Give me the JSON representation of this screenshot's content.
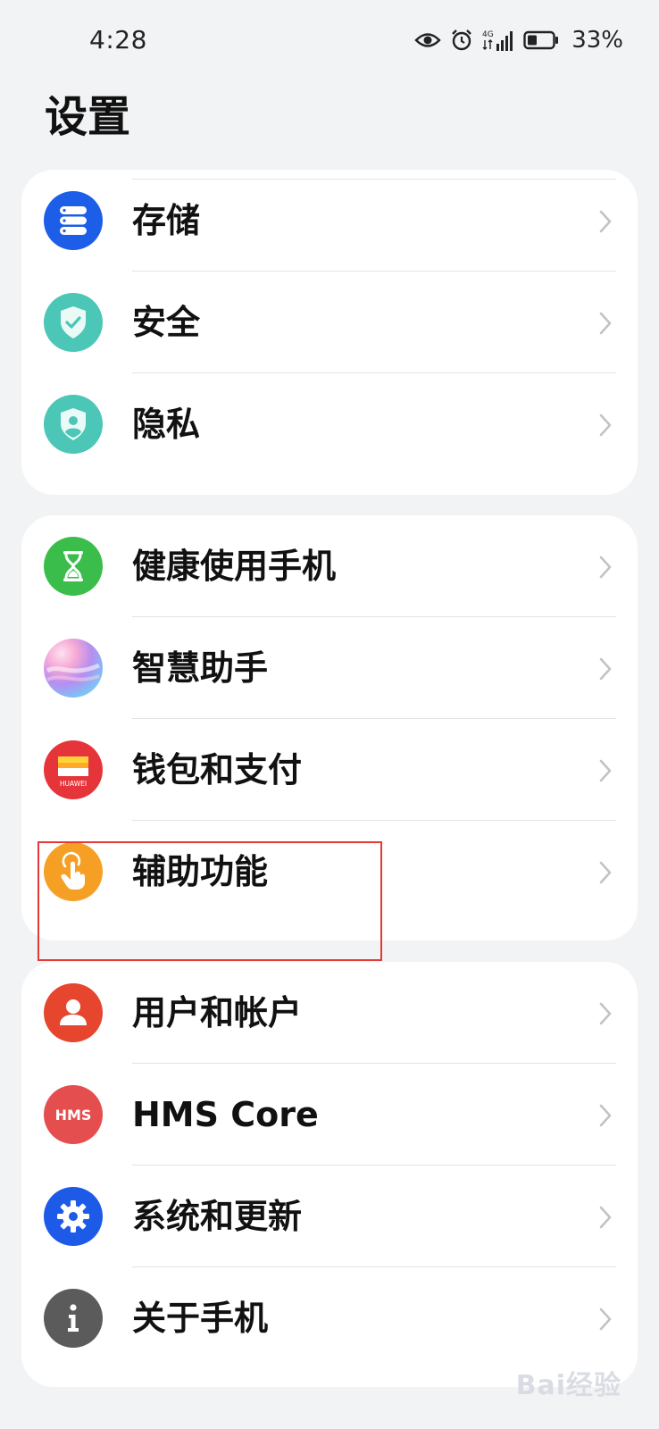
{
  "status_bar": {
    "time": "4:28",
    "network": "4G",
    "battery_percent": "33%"
  },
  "page": {
    "title": "设置"
  },
  "groups": [
    {
      "items": [
        {
          "label": "存储",
          "icon": "storage-icon",
          "color": "#1d5ee8"
        },
        {
          "label": "安全",
          "icon": "shield-check-icon",
          "color": "#4cc6b6"
        },
        {
          "label": "隐私",
          "icon": "privacy-shield-icon",
          "color": "#4cc6b6"
        }
      ]
    },
    {
      "items": [
        {
          "label": "健康使用手机",
          "icon": "hourglass-icon",
          "color": "#3bbd4b"
        },
        {
          "label": "智慧助手",
          "icon": "assistant-orb-icon",
          "color": "#b68ef0"
        },
        {
          "label": "钱包和支付",
          "icon": "wallet-icon",
          "color": "#e5353b",
          "brand": "HUAWEI"
        },
        {
          "label": "辅助功能",
          "icon": "hand-tap-icon",
          "color": "#f5a025"
        }
      ]
    },
    {
      "items": [
        {
          "label": "用户和帐户",
          "icon": "user-icon",
          "color": "#e6452e"
        },
        {
          "label": "HMS Core",
          "icon": "hms-icon",
          "color": "#e44e4e",
          "brand": "HMS"
        },
        {
          "label": "系统和更新",
          "icon": "gear-icon",
          "color": "#1e5ae8"
        },
        {
          "label": "关于手机",
          "icon": "info-icon",
          "color": "#5b5b5b"
        }
      ]
    }
  ],
  "watermark": {
    "text": "Bai经验"
  },
  "colors": {
    "background": "#f1f3f5",
    "card": "#ffffff",
    "highlight": "#e53935"
  }
}
